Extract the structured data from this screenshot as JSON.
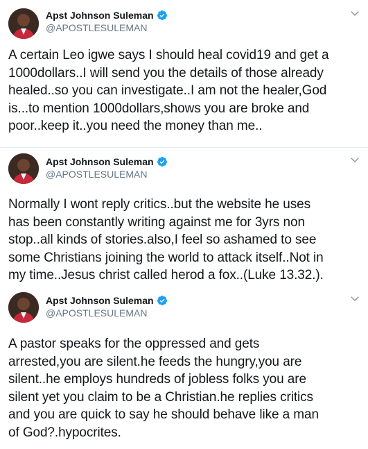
{
  "tweets": [
    {
      "author": {
        "name": "Apst Johnson Suleman",
        "handle": "@APOSTLESULEMAN",
        "avatar_icon": "profile-photo",
        "verified_icon": "verified-badge-icon",
        "verified_color": "#1da1f2"
      },
      "menu_icon": "chevron-down-icon",
      "text": "A certain Leo igwe says I should heal covid19 and get a\n1000dollars..I will send you the details of those already\nhealed..so you can investigate..I am not the healer,God\nis...to mention 1000dollars,shows you are broke and\npoor..keep it..you need the money than me.."
    },
    {
      "author": {
        "name": "Apst Johnson Suleman",
        "handle": "@APOSTLESULEMAN",
        "avatar_icon": "profile-photo",
        "verified_icon": "verified-badge-icon",
        "verified_color": "#1da1f2"
      },
      "menu_icon": "chevron-down-icon",
      "text": "Normally I wont reply critics..but the website he uses\nhas been constantly writing against me for 3yrs non\nstop..all kinds of stories.also,I feel so ashamed to see\nsome Christians joining the world to attack itself..Not in\nmy time..Jesus christ called herod a fox..(Luke 13.32.)."
    },
    {
      "author": {
        "name": "Apst Johnson Suleman",
        "handle": "@APOSTLESULEMAN",
        "avatar_icon": "profile-photo",
        "verified_icon": "verified-badge-icon",
        "verified_color": "#1da1f2"
      },
      "menu_icon": "chevron-down-icon",
      "text": "A pastor speaks for the oppressed and gets\narrested,you are silent.he feeds the hungry,you are\nsilent..he employs hundreds of jobless folks you are\nsilent yet you claim to be a Christian.he replies  critics\nand you are quick to say he should behave like a man\nof God?.hypocrites."
    }
  ]
}
